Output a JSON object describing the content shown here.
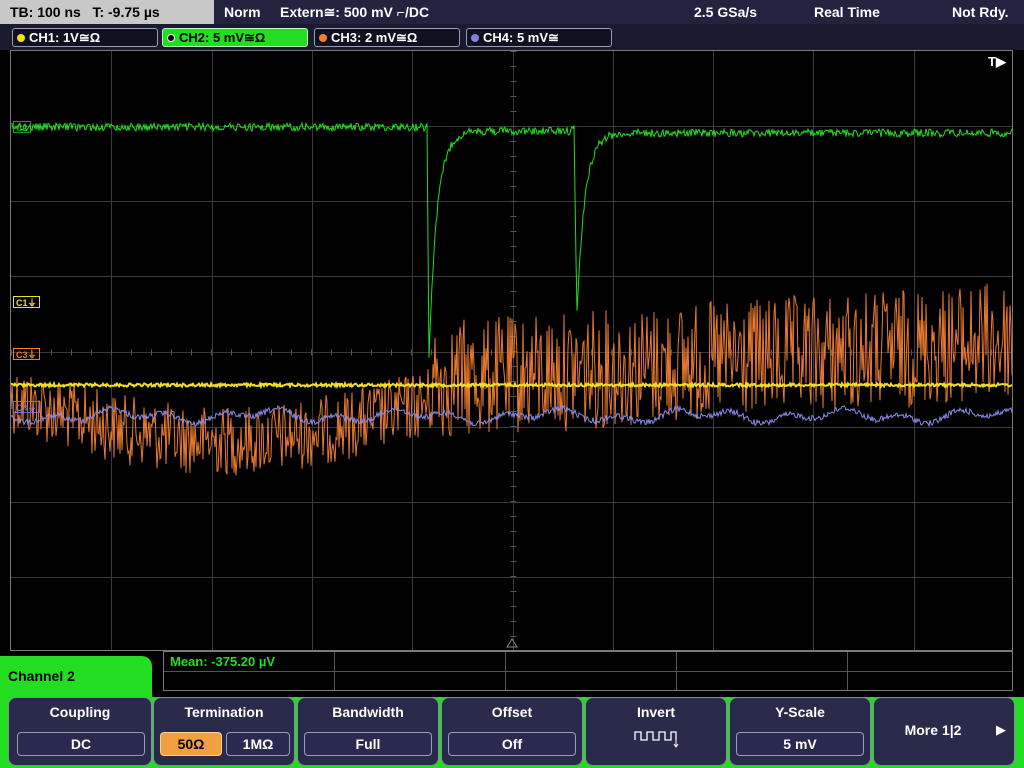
{
  "topbar": {
    "timebase": "TB: 100 ns   T: -9.75 µs",
    "trigger_mode": "Norm",
    "trigger_source": "Extern≅: 500 mV ⌐/DC",
    "sample_rate": "2.5 GSa/s",
    "acq_mode": "Real Time",
    "status": "Not Rdy."
  },
  "channels": [
    {
      "label": "CH1: 1V≅Ω",
      "color": "#f0e020"
    },
    {
      "label": "CH2: 5 mV≅Ω",
      "color": "#22dd22"
    },
    {
      "label": "CH3: 2 mV≅Ω",
      "color": "#f08030"
    },
    {
      "label": "CH4: 5 mV≅",
      "color": "#8080e0"
    }
  ],
  "trigger_marker": "T▶",
  "markers": {
    "c1": "C1⏚",
    "c2": "C2",
    "c3": "C3⏚",
    "c4": "C4⏚"
  },
  "measurement": {
    "mean": "Mean: -375.20 µV"
  },
  "menu": {
    "channel_label": "Channel 2",
    "coupling": {
      "title": "Coupling",
      "value": "DC"
    },
    "termination": {
      "title": "Termination",
      "opt1": "50Ω",
      "opt2": "1MΩ",
      "selected": "50Ω"
    },
    "bandwidth": {
      "title": "Bandwidth",
      "value": "Full"
    },
    "offset": {
      "title": "Offset",
      "value": "Off"
    },
    "invert": {
      "title": "Invert"
    },
    "yscale": {
      "title": "Y-Scale",
      "value": "5 mV"
    },
    "more": {
      "label": "More 1|2"
    }
  }
}
